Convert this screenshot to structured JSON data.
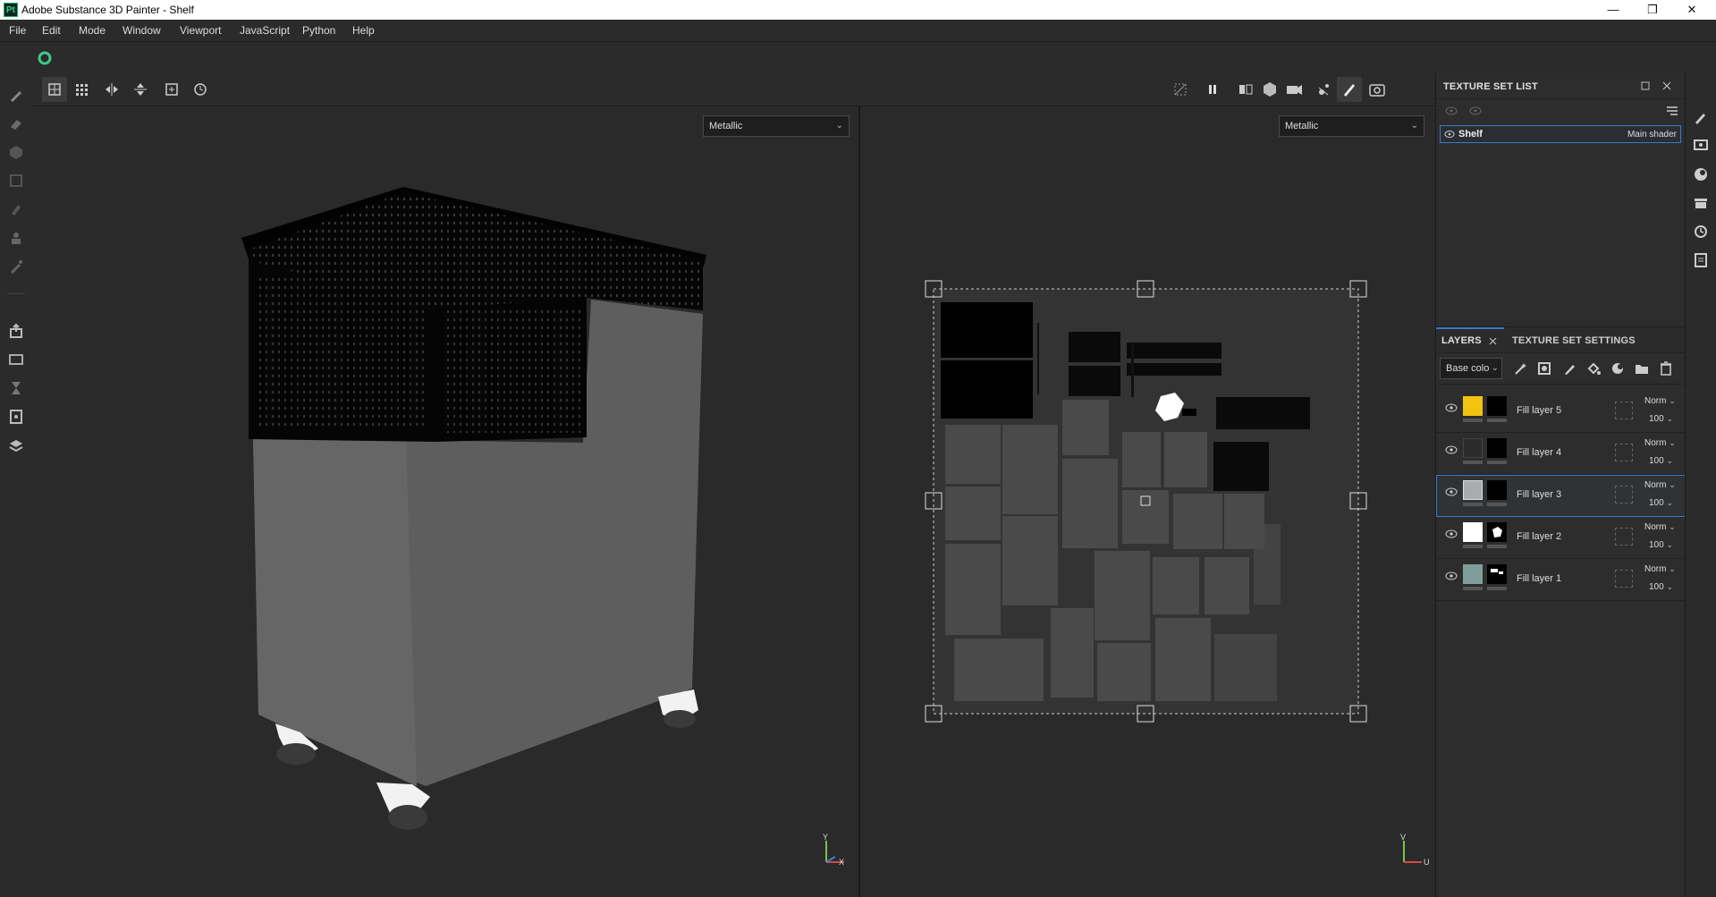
{
  "window": {
    "title": "Adobe Substance 3D Painter - Shelf",
    "app_icon_text": "Pt",
    "minimize": "—",
    "maximize": "❐",
    "close": "✕"
  },
  "menu": [
    "File",
    "Edit",
    "Mode",
    "Window",
    "Viewport",
    "JavaScript",
    "Python",
    "Help"
  ],
  "viewports": {
    "left_channel": "Metallic",
    "right_channel": "Metallic",
    "left_axis": {
      "y": "Y",
      "x": "X"
    },
    "right_axis": {
      "v": "V",
      "u": "U"
    }
  },
  "texture_set_list": {
    "title": "TEXTURE SET LIST",
    "item_name": "Shelf",
    "item_shader": "Main shader"
  },
  "layers_panel": {
    "tabs": [
      "LAYERS",
      "TEXTURE SET SETTINGS"
    ],
    "channel_select": "Base colo",
    "layers": [
      {
        "name": "Fill layer 5",
        "blend": "Norm",
        "opacity": "100",
        "color": "#f2c40f",
        "selected": false
      },
      {
        "name": "Fill layer 4",
        "blend": "Norm",
        "opacity": "100",
        "color": "#2b2b2b",
        "selected": false
      },
      {
        "name": "Fill layer 3",
        "blend": "Norm",
        "opacity": "100",
        "color": "#a8acb0",
        "selected": true
      },
      {
        "name": "Fill layer 2",
        "blend": "Norm",
        "opacity": "100",
        "color": "#ffffff",
        "selected": false
      },
      {
        "name": "Fill layer 1",
        "blend": "Norm",
        "opacity": "100",
        "color": "#7f9e9a",
        "selected": false
      }
    ]
  }
}
